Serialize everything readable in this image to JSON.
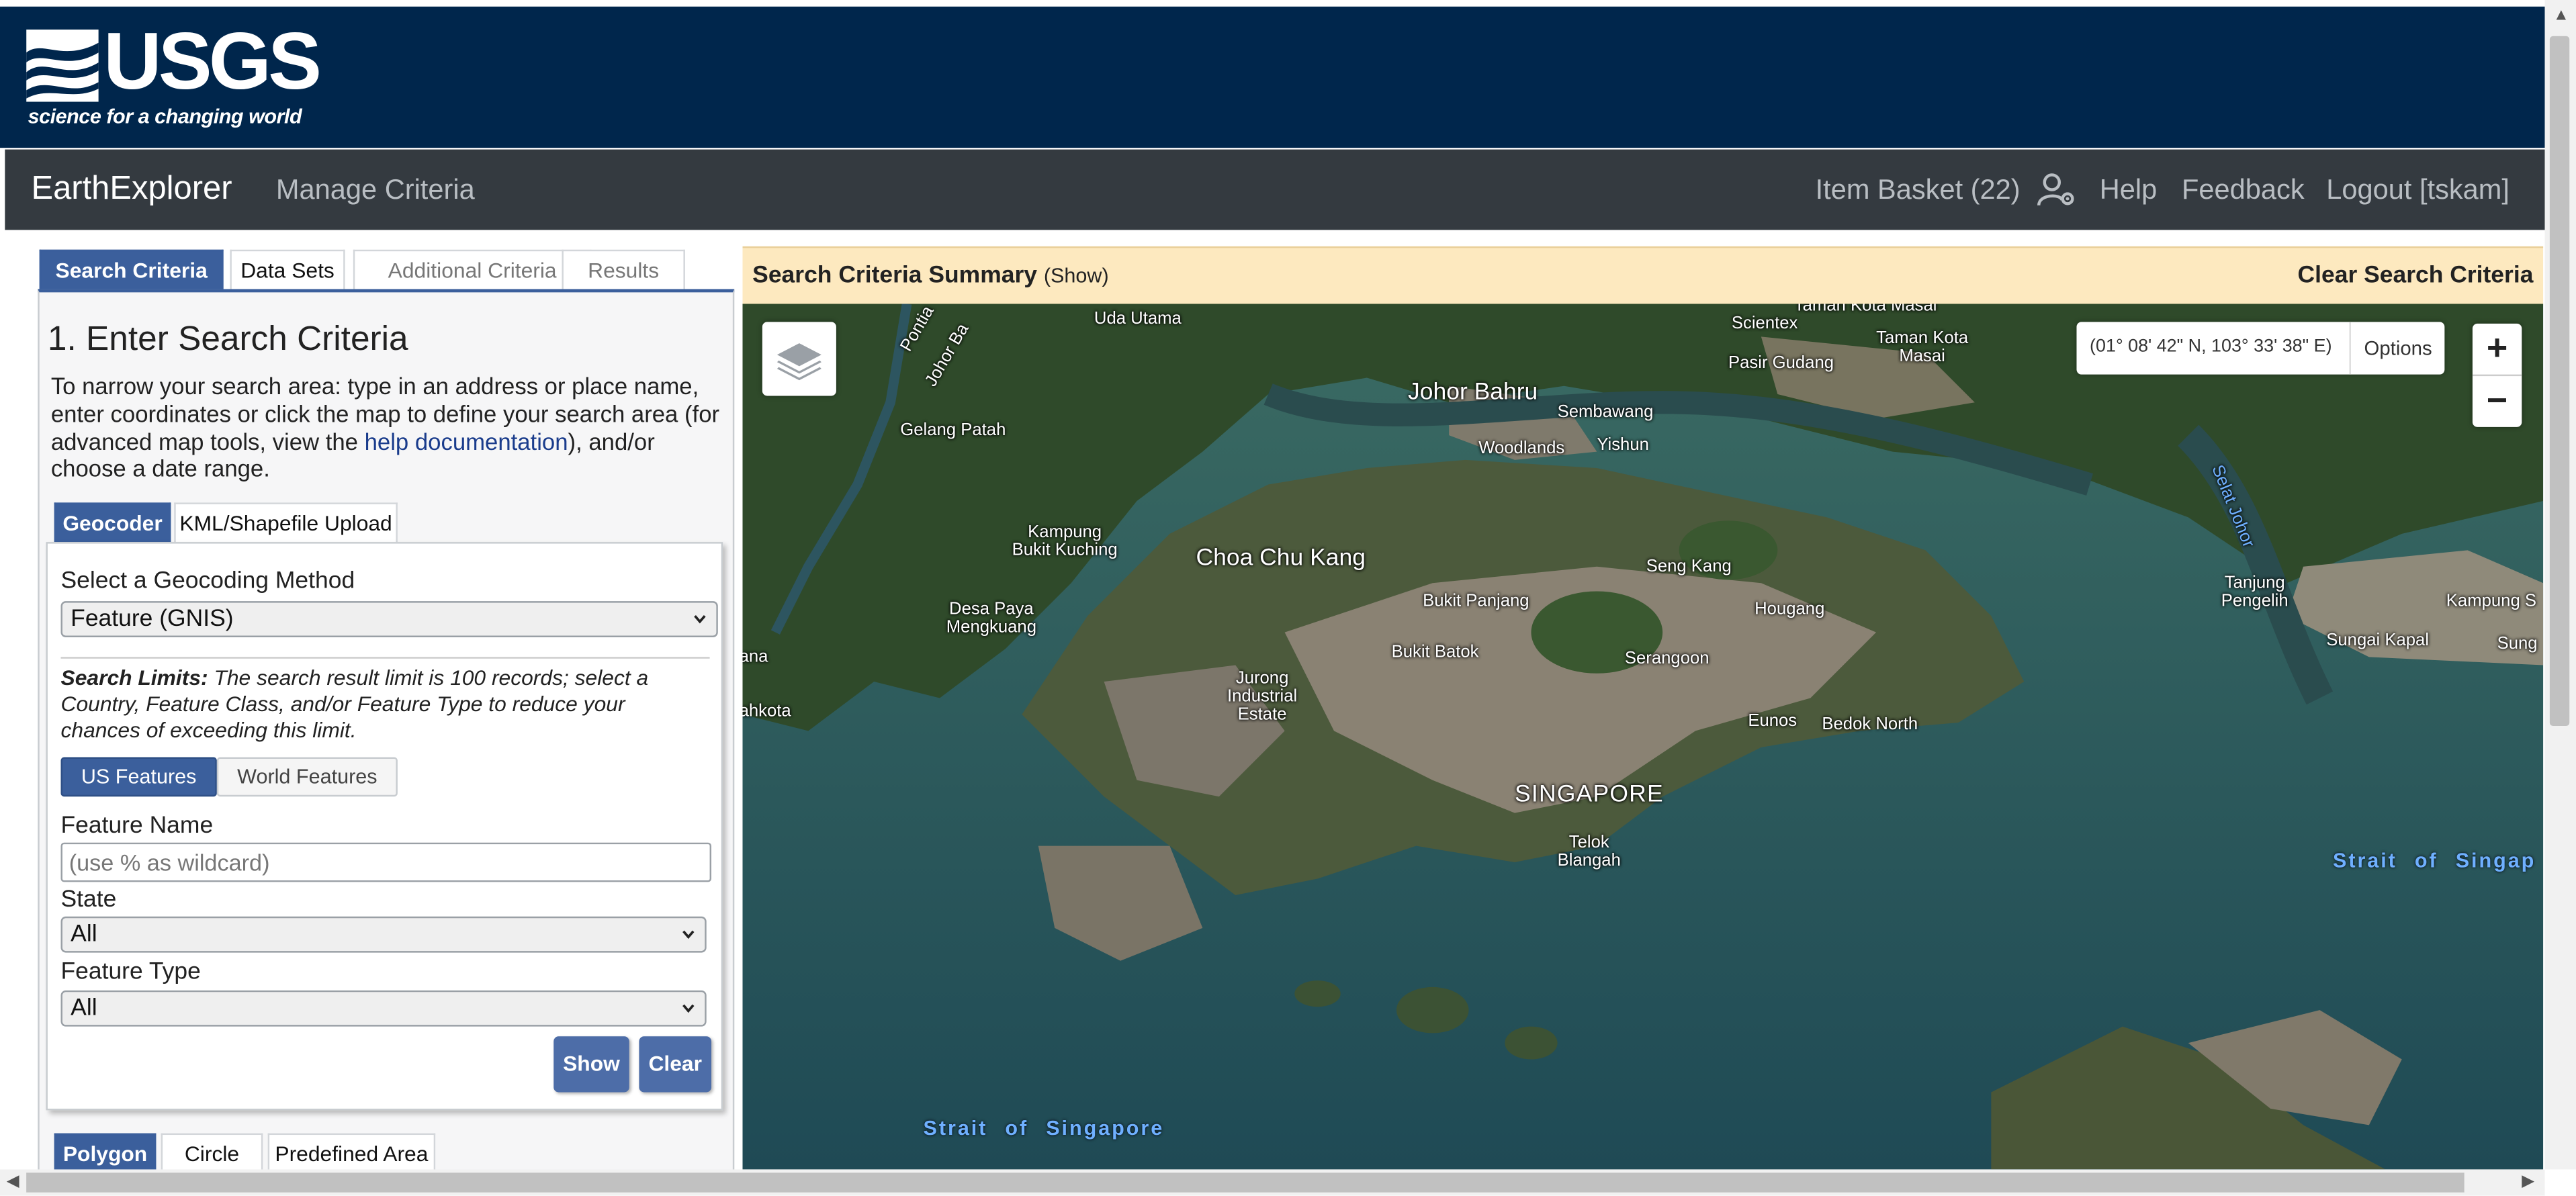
{
  "header": {
    "agency_word": "USGS",
    "tagline": "science for a changing world"
  },
  "nav": {
    "brand": "EarthExplorer",
    "manage_criteria": "Manage Criteria",
    "item_basket": "Item Basket (22)",
    "user_settings_icon": "user-gear-icon",
    "help": "Help",
    "feedback": "Feedback",
    "logout": "Logout [tskam]"
  },
  "tabs": {
    "search_criteria": "Search Criteria",
    "data_sets": "Data Sets",
    "additional_criteria": "Additional Criteria",
    "results": "Results"
  },
  "panel": {
    "heading": "1. Enter Search Criteria",
    "intro_before_link": "To narrow your search area: type in an address or place name, enter coordinates or click the map to define your search area (for advanced map tools, view the ",
    "intro_link": "help documentation",
    "intro_after_link": "), and/or choose a date range.",
    "subtabs": {
      "geocoder": "Geocoder",
      "kml_upload": "KML/Shapefile Upload"
    },
    "geocoding_label": "Select a Geocoding Method",
    "geocoding_value": "Feature (GNIS)",
    "limits_bold": "Search Limits:",
    "limits_text": " The search result limit is 100 records; select a Country, Feature Class, and/or Feature Type to reduce your chances of exceeding this limit.",
    "us_features": "US Features",
    "world_features": "World Features",
    "feature_name_label": "Feature Name",
    "feature_name_placeholder": "(use % as wildcard)",
    "state_label": "State",
    "state_value": "All",
    "feature_type_label": "Feature Type",
    "feature_type_value": "All",
    "show_button": "Show",
    "clear_button": "Clear",
    "shape_tabs": {
      "polygon": "Polygon",
      "circle": "Circle",
      "predefined": "Predefined Area"
    }
  },
  "summary": {
    "title": "Search Criteria Summary",
    "show": "(Show)",
    "clear": "Clear Search Criteria"
  },
  "map": {
    "coordinates": "(01° 08' 42\" N, 103° 33' 38\" E)",
    "options": "Options",
    "zoom_in": "+",
    "zoom_out": "−",
    "labels": {
      "pontian": "Pontia",
      "johor_ba": "Johor Ba",
      "uda_utama": "Uda Utama",
      "taman_kota_masai_top": "Taman Kota Masai",
      "scientex": "Scientex",
      "taman_kota_masai": "Taman Kota\nMasai",
      "pasir_gudang": "Pasir Gudang",
      "johor_bahru": "Johor Bahru",
      "sembawang": "Sembawang",
      "woodlands": "Woodlands",
      "yishun": "Yishun",
      "gelang_patah": "Gelang Patah",
      "kampung_bukit_kuching": "Kampung\nBukit Kuching",
      "choa_chu_kang": "Choa Chu Kang",
      "seng_kang": "Seng Kang",
      "selat_johor": "Selat Johor",
      "tanjung_pengelih": "Tanjung\nPengelih",
      "kampung_s": "Kampung S",
      "desa_paya_mengkuang": "Desa Paya\nMengkuang",
      "bukit_panjang": "Bukit Panjang",
      "hougang": "Hougang",
      "sungai_kapal": "Sungai Kapal",
      "sung": "Sung",
      "ana": "ana",
      "bukit_batok": "Bukit Batok",
      "serangoon": "Serangoon",
      "ahkota": "ahkota",
      "jurong_industrial_estate": "Jurong\nIndustrial\nEstate",
      "eunos": "Eunos",
      "bedok_north": "Bedok North",
      "singapore": "SINGAPORE",
      "telok_blangah": "Telok\nBlangah",
      "strait_singapore_right": "Strait of Singap",
      "strait_singapore_bottom": "Strait of Singapore"
    }
  }
}
